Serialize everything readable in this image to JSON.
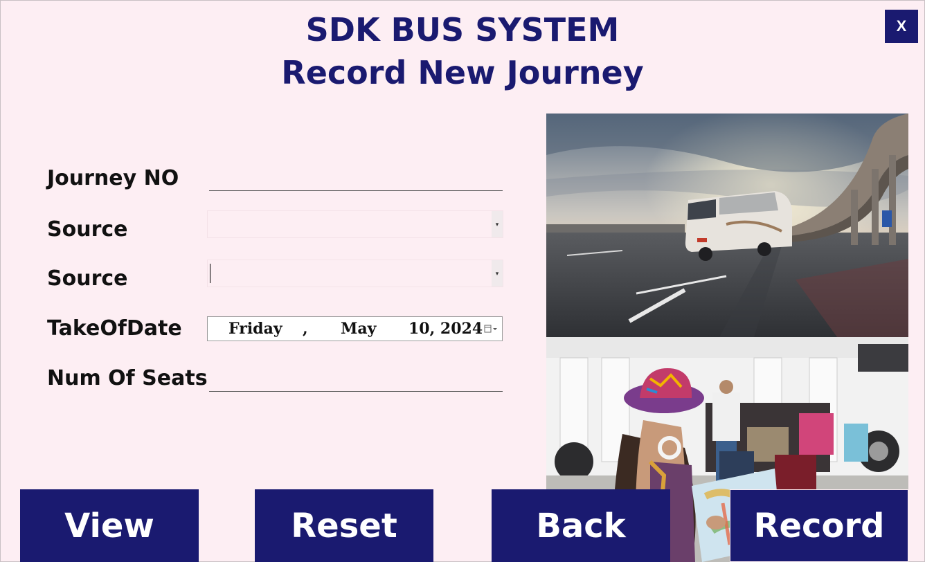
{
  "header": {
    "title": "SDK BUS SYSTEM",
    "subtitle": "Record New Journey",
    "close_label": "X"
  },
  "form": {
    "journey_no_label": "Journey NO",
    "journey_no_value": "",
    "source_label": "Source",
    "source_value": "",
    "destination_label": "Source",
    "destination_value": "",
    "date_label": "TakeOfDate",
    "date_day": "Friday",
    "date_sep": ",",
    "date_month": "May",
    "date_daynum_year": "10, 2024",
    "seats_label": "Num Of Seats",
    "seats_value": ""
  },
  "buttons": {
    "view": "View",
    "reset": "Reset",
    "back": "Back",
    "record": "Record"
  },
  "colors": {
    "accent": "#1a1a70",
    "background": "#fdeef3"
  },
  "images": {
    "top": "bus-on-highway-photo",
    "bottom": "traveler-with-map-photo"
  }
}
